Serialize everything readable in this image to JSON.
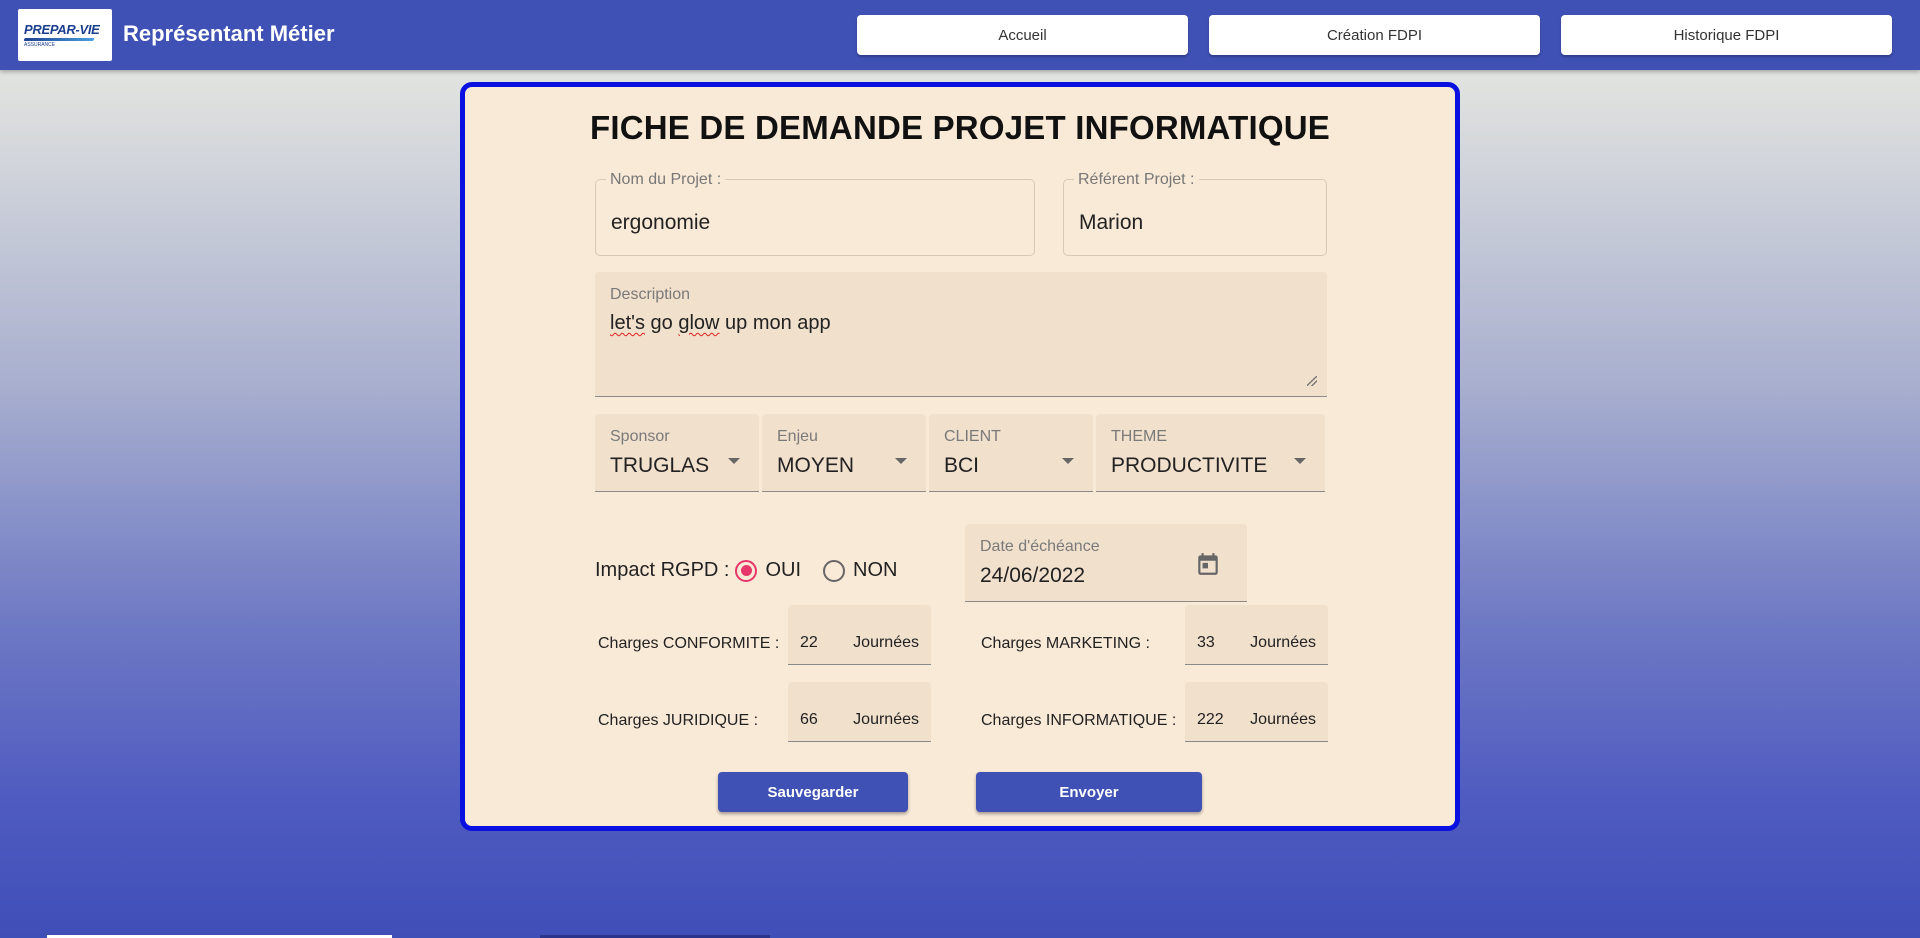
{
  "header": {
    "logo": {
      "name": "PREPAR-VIE",
      "sub": "ASSURANCE"
    },
    "title": "Représentant Métier",
    "nav": [
      {
        "label": "Accueil"
      },
      {
        "label": "Création FDPI"
      },
      {
        "label": "Historique FDPI"
      }
    ],
    "background_color": "#3f51b5"
  },
  "form": {
    "title": "FICHE DE DEMANDE PROJET INFORMATIQUE",
    "nom_projet": {
      "label": "Nom du Projet :",
      "value": "ergonomie"
    },
    "referent": {
      "label": "Référent Projet :",
      "value": "Marion"
    },
    "description": {
      "label": "Description",
      "words": [
        "let's",
        "go",
        "glow",
        "up mon app"
      ]
    },
    "selects": [
      {
        "label": "Sponsor",
        "value": "TRUGLAS"
      },
      {
        "label": "Enjeu",
        "value": "MOYEN"
      },
      {
        "label": "CLIENT",
        "value": "BCI"
      },
      {
        "label": "THEME",
        "value": "PRODUCTIVITE"
      }
    ],
    "rgpd": {
      "label": "Impact RGPD :",
      "options": [
        {
          "label": "OUI",
          "selected": true
        },
        {
          "label": "NON",
          "selected": false
        }
      ]
    },
    "date": {
      "label": "Date d'échéance",
      "value": "24/06/2022",
      "icon": "calendar-icon"
    },
    "charges": {
      "unit": "Journées",
      "conformite": {
        "label": "Charges CONFORMITE :",
        "value": "22"
      },
      "marketing": {
        "label": "Charges MARKETING :",
        "value": "33"
      },
      "juridique": {
        "label": "Charges JURIDIQUE :",
        "value": "66"
      },
      "informatique": {
        "label": "Charges INFORMATIQUE :",
        "value": "222"
      }
    },
    "buttons": {
      "save": "Sauvegarder",
      "send": "Envoyer"
    }
  },
  "colors": {
    "primary": "#3f51b5",
    "card_border": "#0a10e0",
    "card_background": "#f9ead7",
    "radio_selected": "#e8356a"
  }
}
